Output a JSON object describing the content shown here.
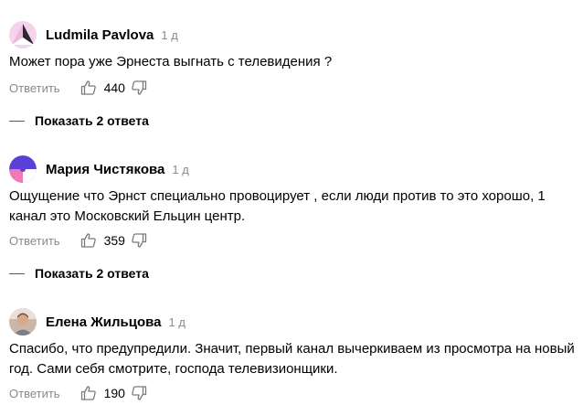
{
  "comments": [
    {
      "author": "Ludmila Pavlova",
      "time": "1 д",
      "text": "Может пора уже Эрнеста выгнать с телевидения ?",
      "reply_label": "Ответить",
      "likes": "440",
      "show_replies": "Показать 2 ответа"
    },
    {
      "author": "Мария Чистякова",
      "time": "1 д",
      "text": "Ощущение что Эрнст специально провоцирует , если люди против то это хорошо, 1 канал это Московский Ельцин центр.",
      "reply_label": "Ответить",
      "likes": "359",
      "show_replies": "Показать 2 ответа"
    },
    {
      "author": "Елена Жильцова",
      "time": "1 д",
      "text": "Спасибо, что предупредили. Значит, первый канал вычеркиваем из просмотра на новый год. Сами себя смотрите, господа телевизионщики.",
      "reply_label": "Ответить",
      "likes": "190"
    }
  ],
  "colors": {
    "text": "#000000",
    "secondary": "#8a8a8a",
    "avatar_pink": "#f2c6e6",
    "avatar_purple": "#6b3fd6",
    "avatar_blue": "#3b5bdb"
  },
  "icons": [
    "thumbs-up-icon",
    "thumbs-down-icon"
  ]
}
